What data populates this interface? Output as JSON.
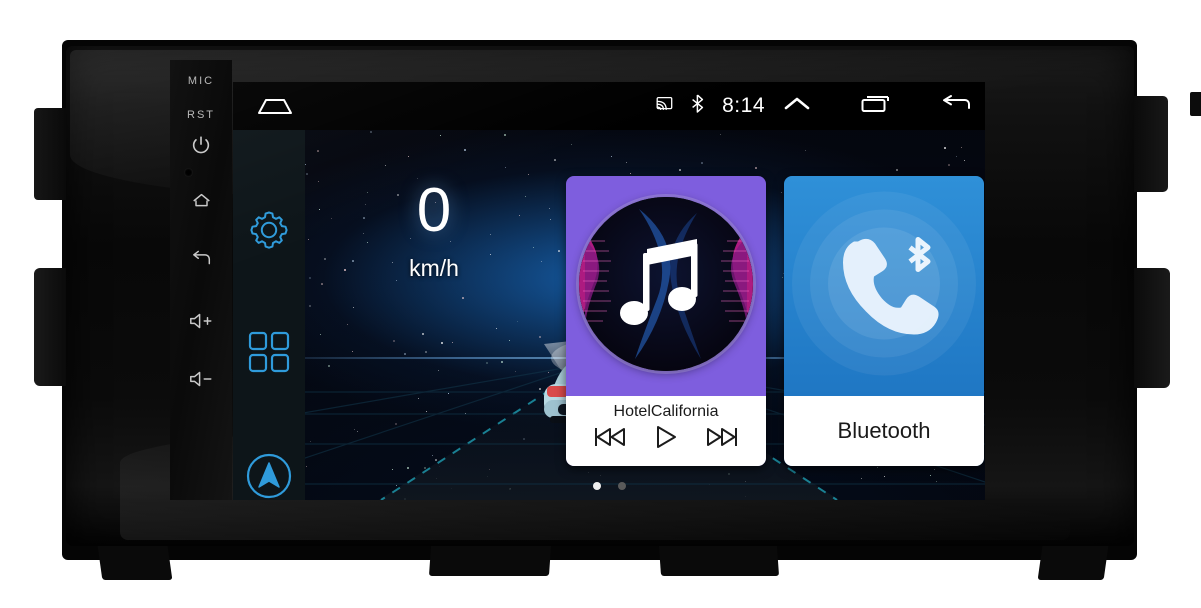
{
  "device": {
    "brand_label": "MIC",
    "reset_label": "RST",
    "hard_keys": [
      {
        "name": "mic-label",
        "label": "MIC"
      },
      {
        "name": "reset-label",
        "label": "RST"
      },
      {
        "name": "power-key",
        "label": "power-icon"
      },
      {
        "name": "home-key",
        "label": "home-icon"
      },
      {
        "name": "back-key",
        "label": "back-icon"
      },
      {
        "name": "volume-up-key",
        "label": "volume-up-icon"
      },
      {
        "name": "volume-down-key",
        "label": "volume-down-icon"
      }
    ]
  },
  "statusbar": {
    "home_icon": "home-icon",
    "cast_icon": "cast-icon",
    "bluetooth_icon": "bluetooth-icon",
    "clock": "8:14",
    "expand_icon": "chevron-up-icon",
    "recents_icon": "recents-icon",
    "back_icon": "back-arrow-icon"
  },
  "dock": {
    "items": [
      {
        "name": "settings",
        "icon": "gear-icon",
        "label": "Settings"
      },
      {
        "name": "apps",
        "icon": "apps-grid-icon",
        "label": "Apps"
      },
      {
        "name": "navigation",
        "icon": "navigation-arrow-icon",
        "label": "Navigation"
      }
    ]
  },
  "speed_widget": {
    "value": "0",
    "unit": "km/h"
  },
  "music_widget": {
    "title": "HotelCalifornia",
    "album_art_icon": "music-note-icon",
    "controls": [
      {
        "name": "previous-track-button",
        "icon": "skip-previous-icon"
      },
      {
        "name": "play-button",
        "icon": "play-icon"
      },
      {
        "name": "next-track-button",
        "icon": "skip-next-icon"
      }
    ],
    "accent_color": "#7e5ede"
  },
  "bluetooth_widget": {
    "title": "Bluetooth",
    "icon": "bluetooth-phone-icon",
    "accent_color": "#2f90d8"
  },
  "pager": {
    "pages": 2,
    "active_index": 0
  },
  "colors": {
    "dock_background": "#0d1519",
    "dock_icon": "#2f9bdb",
    "screen_background": "#05060a",
    "statusbar_background": "#000000"
  }
}
